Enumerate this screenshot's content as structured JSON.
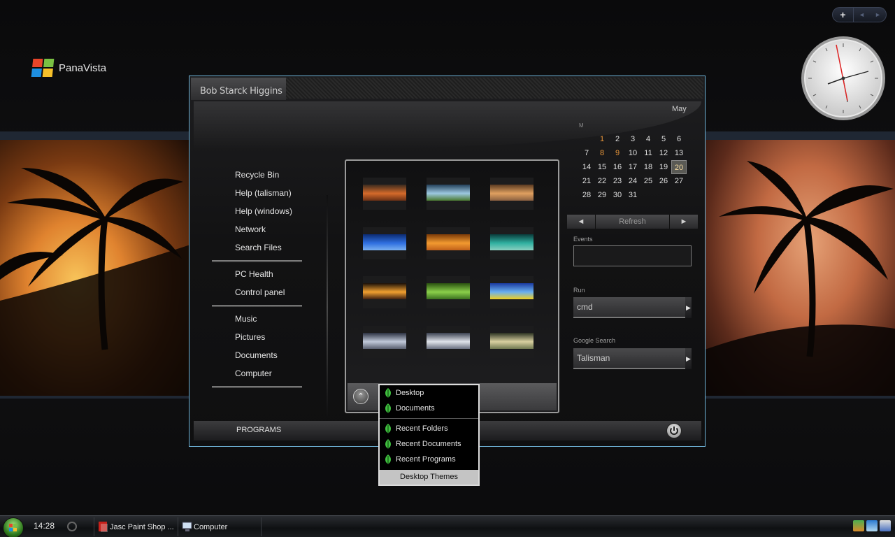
{
  "desktop": {
    "logo_text": "PanaVista"
  },
  "start_menu": {
    "user_name": "Bob Starck Higgins",
    "nav_groups": [
      [
        "Recycle Bin",
        "Help (talisman)",
        "Help (windows)",
        "Network",
        "Search Files"
      ],
      [
        "PC Health",
        "Control panel"
      ],
      [
        "Music",
        "Pictures",
        "Documents",
        "Computer"
      ]
    ],
    "programs_label": "PROGRAMS",
    "theme_thumbs": [
      {
        "colors": [
          "#3a2a1e",
          "#d46a2a",
          "#6b3015"
        ]
      },
      {
        "colors": [
          "#23405a",
          "#9cc8e0",
          "#4a7a30"
        ]
      },
      {
        "colors": [
          "#5a3a20",
          "#e0a060",
          "#8a6040"
        ]
      },
      {
        "colors": [
          "#0c2a70",
          "#2f6fe0",
          "#7ab0f0"
        ]
      },
      {
        "colors": [
          "#7a3a08",
          "#f29a30",
          "#c0601a"
        ]
      },
      {
        "colors": [
          "#0a3a3a",
          "#2fb0a0",
          "#8ad0c0"
        ]
      },
      {
        "colors": [
          "#1a1008",
          "#f2a030",
          "#402010"
        ]
      },
      {
        "colors": [
          "#2a5010",
          "#8ad04a",
          "#3a7020"
        ]
      },
      {
        "colors": [
          "#1a3aa0",
          "#6ab0f0",
          "#f0d020"
        ]
      },
      {
        "colors": [
          "#2a3040",
          "#c0c8d8",
          "#5a6070"
        ]
      },
      {
        "colors": [
          "#3a4050",
          "#e0e4ea",
          "#6a7080"
        ]
      },
      {
        "colors": [
          "#2a3020",
          "#d8d0a0",
          "#707850"
        ]
      }
    ]
  },
  "calendar": {
    "month": "May",
    "dow_label": "M",
    "weeks": [
      [
        "",
        "1",
        "2",
        "3",
        "4",
        "5",
        "6"
      ],
      [
        "7",
        "8",
        "9",
        "10",
        "11",
        "12",
        "13"
      ],
      [
        "14",
        "15",
        "16",
        "17",
        "18",
        "19",
        "20"
      ],
      [
        "21",
        "22",
        "23",
        "24",
        "25",
        "26",
        "27"
      ],
      [
        "28",
        "29",
        "30",
        "31",
        "",
        "",
        ""
      ]
    ],
    "highlighted_days": [
      "1",
      "8",
      "9"
    ],
    "today": "20",
    "refresh_label": "Refresh",
    "prev_icon": "left-arrow",
    "next_icon": "right-arrow"
  },
  "widgets": {
    "events_label": "Events",
    "run_label": "Run",
    "run_value": "cmd",
    "google_label": "Google Search",
    "google_value": "Talisman"
  },
  "context_menu": {
    "group1": [
      "Desktop",
      "Documents"
    ],
    "group2": [
      "Recent Folders",
      "Recent Documents",
      "Recent Programs"
    ],
    "themes_label": "Desktop Themes",
    "leaf_color": "#3fbf3f"
  },
  "taskbar": {
    "time": "14:28",
    "buttons": [
      {
        "label": "Jasc Paint Shop ...",
        "icon": "paint-shop-icon"
      },
      {
        "label": "Computer",
        "icon": "computer-icon"
      }
    ]
  },
  "colors": {
    "accent_border": "#6fb4d8",
    "highlight_day": "#e8963a"
  }
}
